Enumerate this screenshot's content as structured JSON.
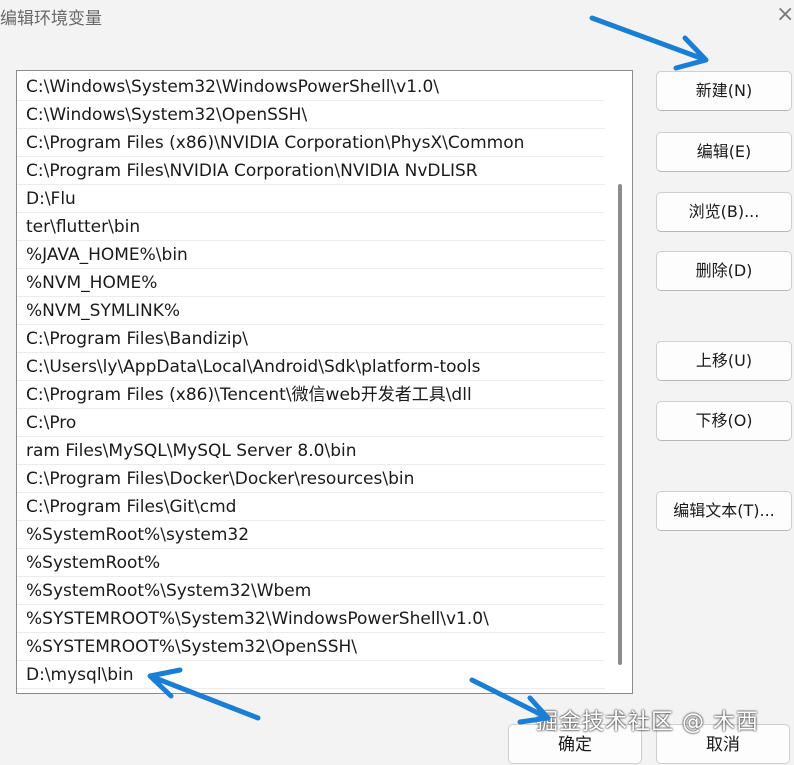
{
  "window": {
    "title": "编辑环境变量",
    "close_glyph": "×"
  },
  "paths": [
    "C:\\Windows\\System32\\WindowsPowerShell\\v1.0\\",
    "C:\\Windows\\System32\\OpenSSH\\",
    "C:\\Program Files (x86)\\NVIDIA Corporation\\PhysX\\Common",
    "C:\\Program Files\\NVIDIA Corporation\\NVIDIA NvDLISR",
    "D:\\Flu",
    "ter\\flutter\\bin",
    "%JAVA_HOME%\\bin",
    "%NVM_HOME%",
    "%NVM_SYMLINK%",
    "C:\\Program Files\\Bandizip\\",
    "C:\\Users\\ly\\AppData\\Local\\Android\\Sdk\\platform-tools",
    "C:\\Program Files (x86)\\Tencent\\微信web开发者工具\\dll",
    "C:\\Pro",
    "ram Files\\MySQL\\MySQL Server 8.0\\bin",
    "C:\\Program Files\\Docker\\Docker\\resources\\bin",
    "C:\\Program Files\\Git\\cmd",
    "%SystemRoot%\\system32",
    "%SystemRoot%",
    "%SystemRoot%\\System32\\Wbem",
    "%SYSTEMROOT%\\System32\\WindowsPowerShell\\v1.0\\",
    "%SYSTEMROOT%\\System32\\OpenSSH\\",
    "D:\\mysql\\bin"
  ],
  "buttons": {
    "new": "新建(N)",
    "edit": "编辑(E)",
    "browse": "浏览(B)...",
    "delete": "删除(D)",
    "move_up": "上移(U)",
    "move_down": "下移(O)",
    "edit_text": "编辑文本(T)...",
    "ok": "确定",
    "cancel": "取消"
  },
  "watermark": "掘金技术社区 @ 木西",
  "annotation_color": "#1a7fd4"
}
